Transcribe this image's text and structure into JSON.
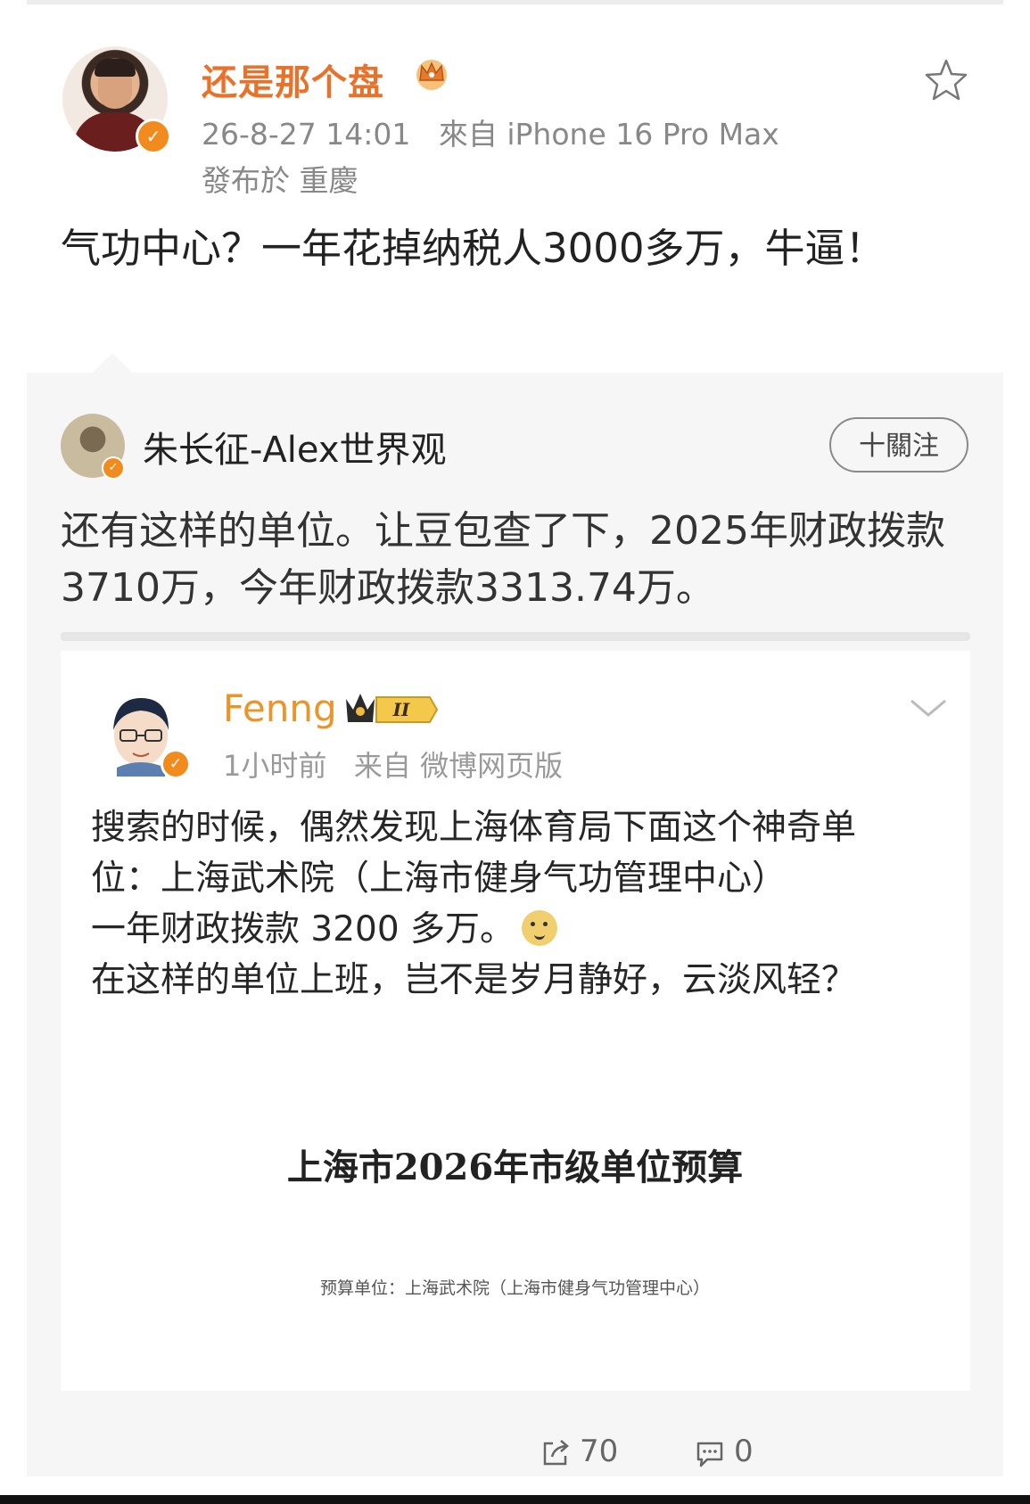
{
  "post": {
    "username": "还是那个盘",
    "timestamp": "26-8-27 14:01",
    "source": "來自 iPhone 16 Pro Max",
    "location": "發布於 重慶",
    "text": "气功中心？一年花掉纳税人3000多万，牛逼！"
  },
  "repost": {
    "username": "朱长征-Alex世界观",
    "follow_label": "十關注",
    "text": "还有这样的单位。让豆包查了下，2025年财政拨款3710万，今年财政拨款3313.74万。"
  },
  "quoted": {
    "username": "Fenng",
    "level_badge": "II",
    "time": "1小时前",
    "source": "来自 微博网页版",
    "lines": [
      "搜索的时候，偶然发现上海体育局下面这个神奇单",
      "位：上海武术院（上海市健身气功管理中心）",
      "一年财政拨款 3200 多万。",
      "在这样的单位上班，岂不是岁月静好，云淡风轻？"
    ],
    "doc_title": "上海市2026年市级单位预算",
    "doc_subtitle": "预算单位：上海武术院（上海市健身气功管理中心）"
  },
  "actions": {
    "share_count": "70",
    "comment_count": "0"
  },
  "colors": {
    "accent_orange": "#e9712a",
    "verified_badge": "#f28b1e"
  }
}
